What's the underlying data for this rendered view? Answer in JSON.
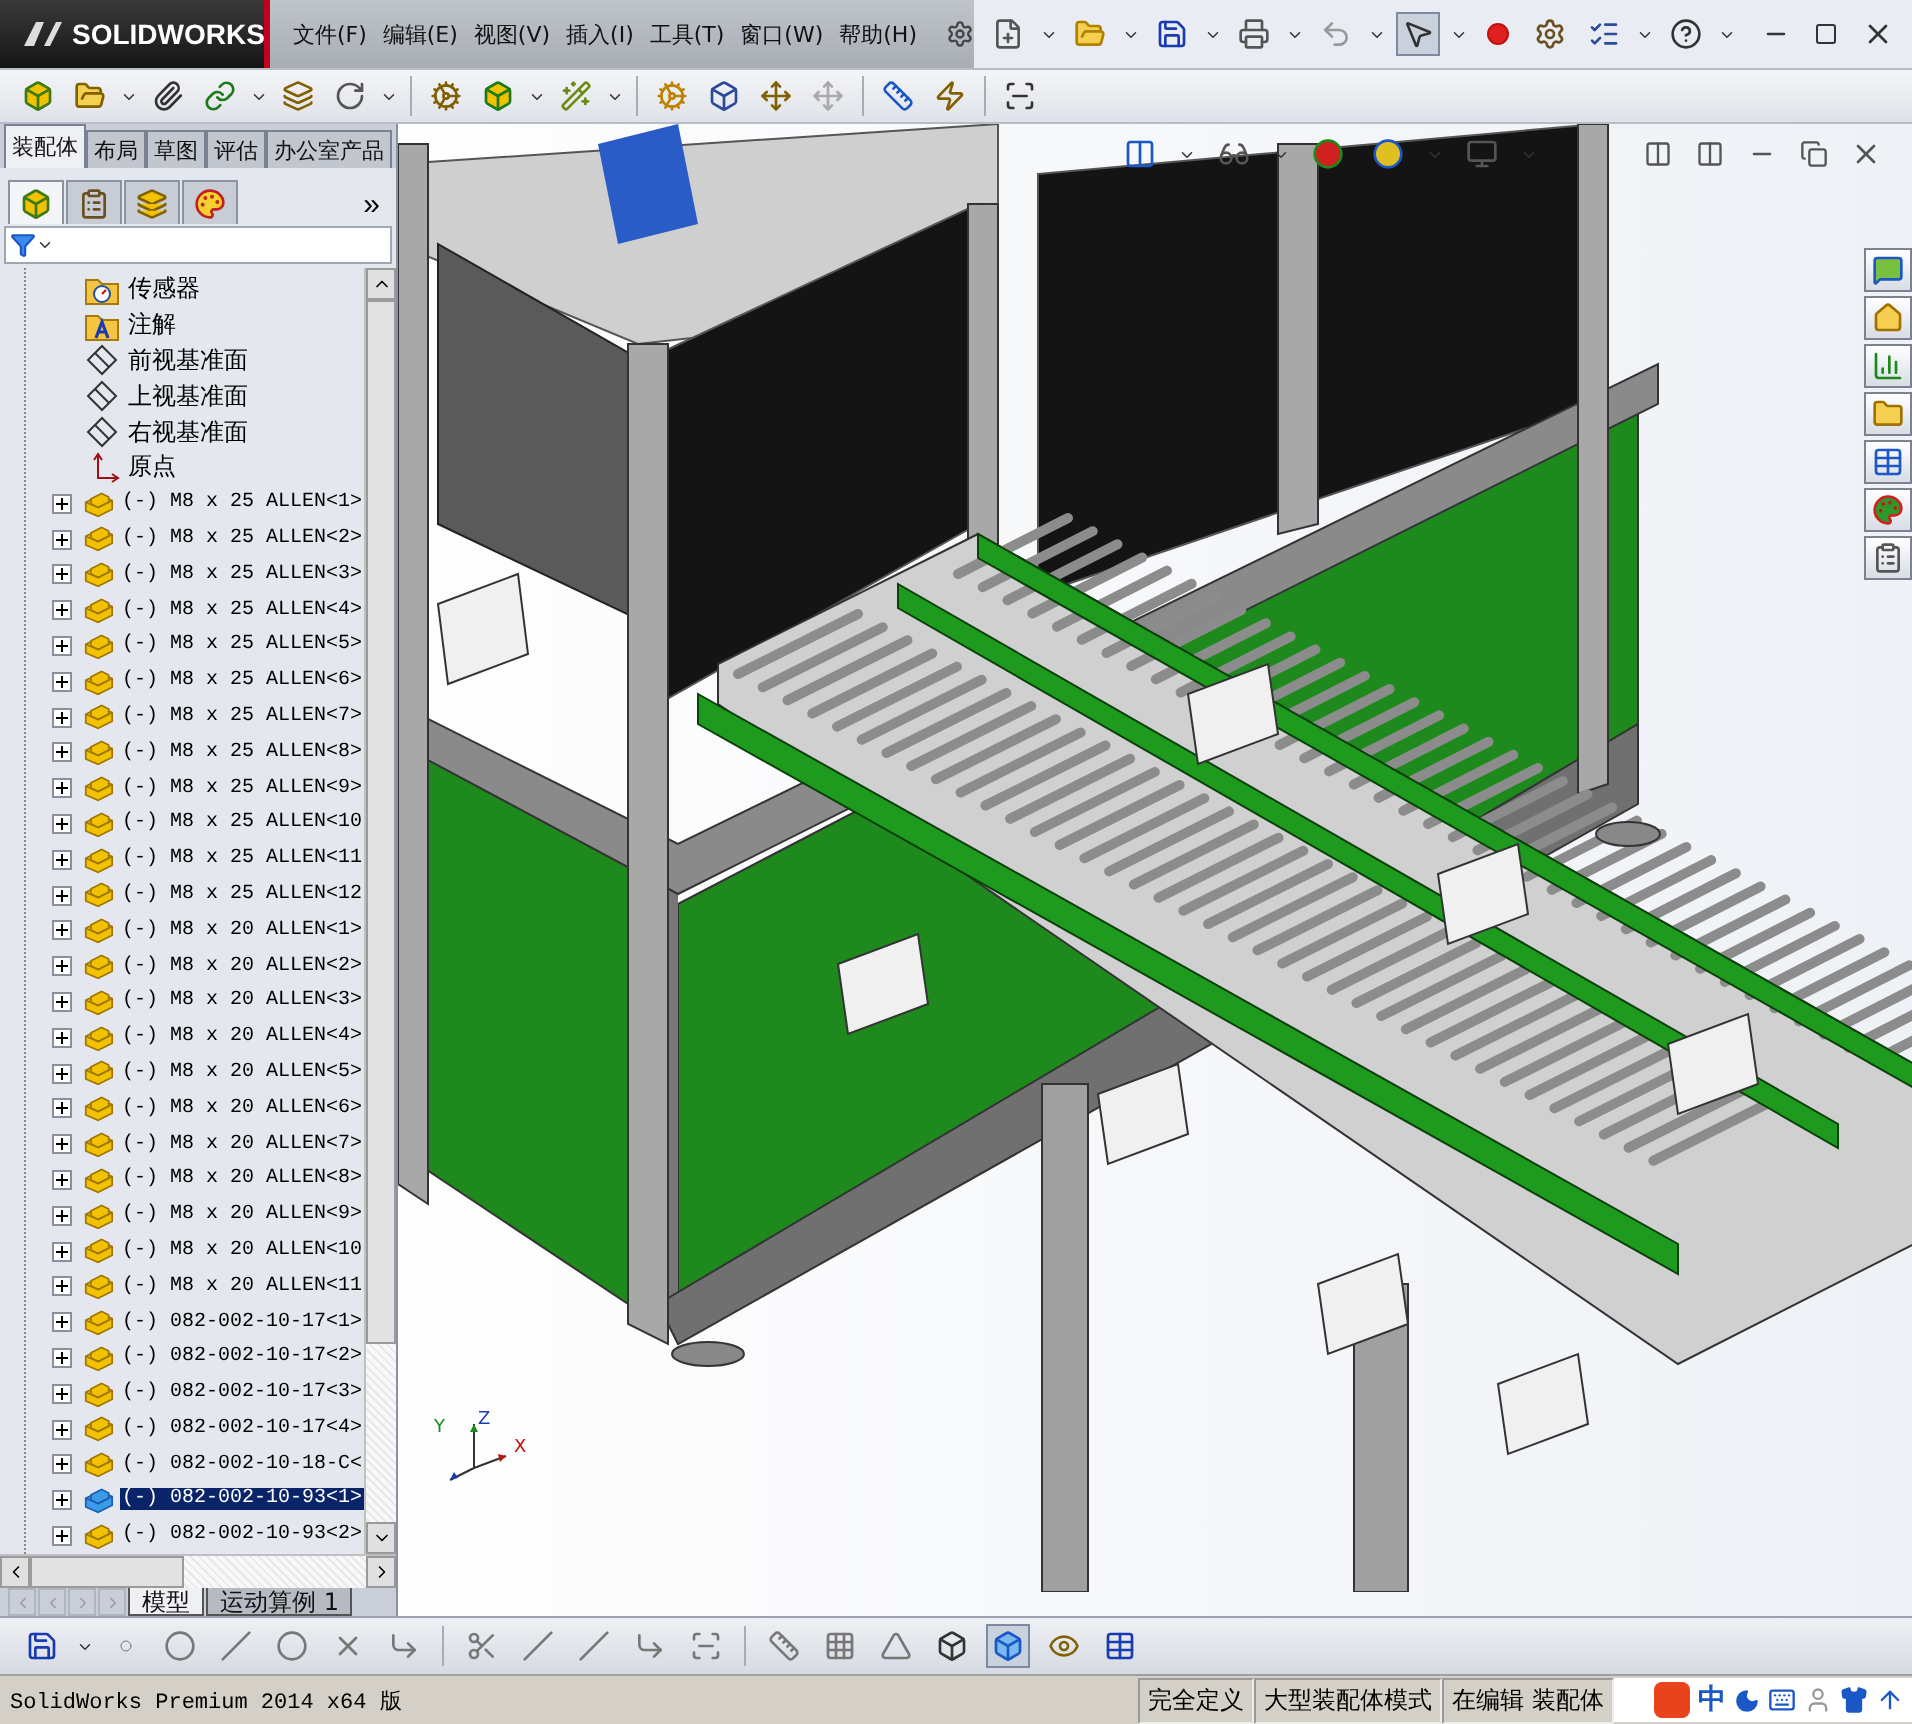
{
  "app": {
    "logo": "SOLIDWORKS"
  },
  "menu": [
    "文件(F)",
    "编辑(E)",
    "视图(V)",
    "插入(I)",
    "工具(T)",
    "窗口(W)",
    "帮助(H)"
  ],
  "command_tabs": [
    {
      "label": "装配体",
      "selected": true
    },
    {
      "label": "布局",
      "selected": false
    },
    {
      "label": "草图",
      "selected": false
    },
    {
      "label": "评估",
      "selected": false
    },
    {
      "label": "办公室产品",
      "selected": false
    }
  ],
  "panel_tabs": [
    {
      "kind": "feature-tree",
      "selected": true
    },
    {
      "kind": "property",
      "selected": false
    },
    {
      "kind": "config",
      "selected": false
    },
    {
      "kind": "display",
      "selected": false
    }
  ],
  "panel_more": "»",
  "tree": [
    {
      "kind": "sensor",
      "label": "传感器"
    },
    {
      "kind": "annotation",
      "label": "注解"
    },
    {
      "kind": "plane",
      "label": "前视基准面"
    },
    {
      "kind": "plane",
      "label": "上视基准面"
    },
    {
      "kind": "plane",
      "label": "右视基准面"
    },
    {
      "kind": "origin",
      "label": "原点"
    },
    {
      "kind": "component",
      "label": "(-) M8 x 25 ALLEN<1>",
      "expanded": false,
      "selected": false
    },
    {
      "kind": "component",
      "label": "(-) M8 x 25 ALLEN<2>",
      "expanded": false,
      "selected": false
    },
    {
      "kind": "component",
      "label": "(-) M8 x 25 ALLEN<3>",
      "expanded": false,
      "selected": false
    },
    {
      "kind": "component",
      "label": "(-) M8 x 25 ALLEN<4>",
      "expanded": false,
      "selected": false
    },
    {
      "kind": "component",
      "label": "(-) M8 x 25 ALLEN<5>",
      "expanded": false,
      "selected": false
    },
    {
      "kind": "component",
      "label": "(-) M8 x 25 ALLEN<6>",
      "expanded": false,
      "selected": false
    },
    {
      "kind": "component",
      "label": "(-) M8 x 25 ALLEN<7>",
      "expanded": false,
      "selected": false
    },
    {
      "kind": "component",
      "label": "(-) M8 x 25 ALLEN<8>",
      "expanded": false,
      "selected": false
    },
    {
      "kind": "component",
      "label": "(-) M8 x 25 ALLEN<9>",
      "expanded": false,
      "selected": false
    },
    {
      "kind": "component",
      "label": "(-) M8 x 25 ALLEN<10",
      "expanded": false,
      "selected": false
    },
    {
      "kind": "component",
      "label": "(-) M8 x 25 ALLEN<11",
      "expanded": false,
      "selected": false
    },
    {
      "kind": "component",
      "label": "(-) M8 x 25 ALLEN<12",
      "expanded": false,
      "selected": false
    },
    {
      "kind": "component",
      "label": "(-) M8 x 20 ALLEN<1>",
      "expanded": false,
      "selected": false
    },
    {
      "kind": "component",
      "label": "(-) M8 x 20 ALLEN<2>",
      "expanded": false,
      "selected": false
    },
    {
      "kind": "component",
      "label": "(-) M8 x 20 ALLEN<3>",
      "expanded": false,
      "selected": false
    },
    {
      "kind": "component",
      "label": "(-) M8 x 20 ALLEN<4>",
      "expanded": false,
      "selected": false
    },
    {
      "kind": "component",
      "label": "(-) M8 x 20 ALLEN<5>",
      "expanded": false,
      "selected": false
    },
    {
      "kind": "component",
      "label": "(-) M8 x 20 ALLEN<6>",
      "expanded": false,
      "selected": false
    },
    {
      "kind": "component",
      "label": "(-) M8 x 20 ALLEN<7>",
      "expanded": false,
      "selected": false
    },
    {
      "kind": "component",
      "label": "(-) M8 x 20 ALLEN<8>",
      "expanded": false,
      "selected": false
    },
    {
      "kind": "component",
      "label": "(-) M8 x 20 ALLEN<9>",
      "expanded": false,
      "selected": false
    },
    {
      "kind": "component",
      "label": "(-) M8 x 20 ALLEN<10",
      "expanded": false,
      "selected": false
    },
    {
      "kind": "component",
      "label": "(-) M8 x 20 ALLEN<11",
      "expanded": false,
      "selected": false
    },
    {
      "kind": "component",
      "label": "(-) 082-002-10-17<1>",
      "expanded": false,
      "selected": false
    },
    {
      "kind": "component",
      "label": "(-) 082-002-10-17<2>",
      "expanded": false,
      "selected": false
    },
    {
      "kind": "component",
      "label": "(-) 082-002-10-17<3>",
      "expanded": false,
      "selected": false
    },
    {
      "kind": "component",
      "label": "(-) 082-002-10-17<4>",
      "expanded": false,
      "selected": false
    },
    {
      "kind": "component",
      "label": "(-) 082-002-10-18-C<",
      "expanded": false,
      "selected": false
    },
    {
      "kind": "component",
      "label": "(-) 082-002-10-93<1>",
      "expanded": false,
      "selected": true
    },
    {
      "kind": "component",
      "label": "(-) 082-002-10-93<2>",
      "expanded": false,
      "selected": false
    }
  ],
  "bottom_tabs": [
    {
      "label": "模型",
      "selected": true
    },
    {
      "label": "运动算例 1",
      "selected": false
    }
  ],
  "triad": [
    "Y",
    "Z",
    "X"
  ],
  "status_bar": {
    "product": "SolidWorks Premium 2014 x64 版",
    "fields": [
      "完全定义",
      "大型装配体模式",
      "在编辑 装配体"
    ],
    "ime": "中"
  }
}
